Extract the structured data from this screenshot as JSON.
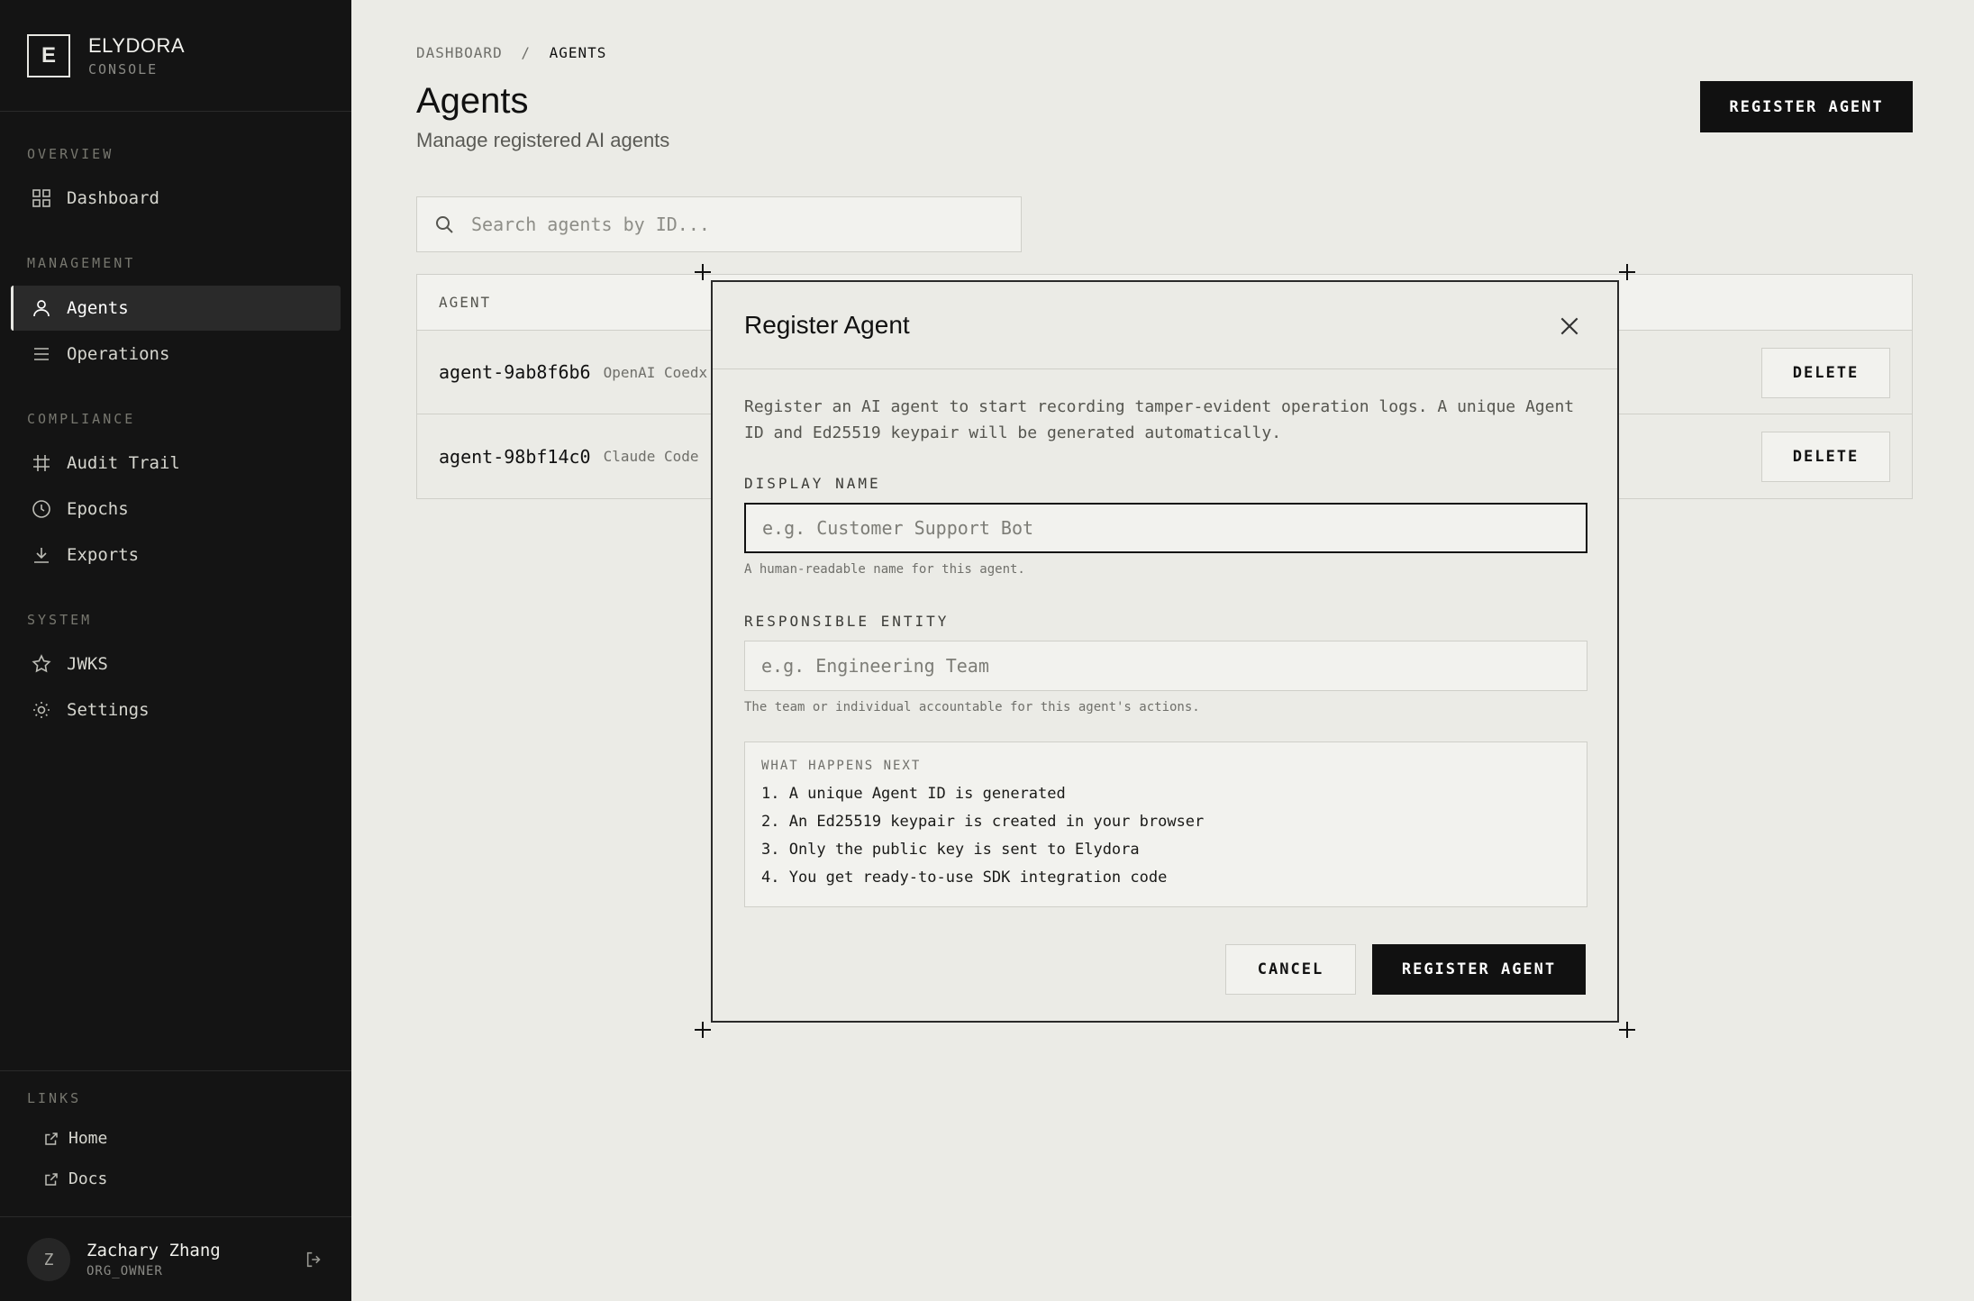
{
  "brand": {
    "letter": "E",
    "name": "ELYDORA",
    "sub": "CONSOLE"
  },
  "sidebar": {
    "sections": [
      {
        "title": "OVERVIEW",
        "items": [
          {
            "label": "Dashboard",
            "icon": "grid-icon"
          }
        ]
      },
      {
        "title": "MANAGEMENT",
        "items": [
          {
            "label": "Agents",
            "icon": "user-icon",
            "active": true
          },
          {
            "label": "Operations",
            "icon": "list-icon"
          }
        ]
      },
      {
        "title": "COMPLIANCE",
        "items": [
          {
            "label": "Audit Trail",
            "icon": "hash-icon"
          },
          {
            "label": "Epochs",
            "icon": "clock-icon"
          },
          {
            "label": "Exports",
            "icon": "download-icon"
          }
        ]
      },
      {
        "title": "SYSTEM",
        "items": [
          {
            "label": "JWKS",
            "icon": "star-icon"
          },
          {
            "label": "Settings",
            "icon": "sun-icon"
          }
        ]
      }
    ],
    "links": {
      "title": "LINKS",
      "items": [
        {
          "label": "Home"
        },
        {
          "label": "Docs"
        }
      ]
    },
    "user": {
      "initial": "Z",
      "name": "Zachary Zhang",
      "role": "ORG_OWNER"
    }
  },
  "header": {
    "breadcrumb": {
      "root": "DASHBOARD",
      "sep": "/",
      "current": "AGENTS"
    },
    "title": "Agents",
    "subtitle": "Manage registered AI agents",
    "register_label": "REGISTER AGENT"
  },
  "search": {
    "placeholder": "Search agents by ID..."
  },
  "table": {
    "header": "AGENT",
    "rows": [
      {
        "id": "agent-9ab8f6b6",
        "type": "OpenAI Coedx",
        "action": "DELETE"
      },
      {
        "id": "agent-98bf14c0",
        "type": "Claude Code",
        "action": "DELETE"
      }
    ]
  },
  "modal": {
    "title": "Register Agent",
    "description": "Register an AI agent to start recording tamper-evident operation logs. A unique Agent ID and Ed25519 keypair will be generated automatically.",
    "display_name": {
      "label": "DISPLAY NAME",
      "placeholder": "e.g. Customer Support Bot",
      "hint": "A human-readable name for this agent."
    },
    "responsible_entity": {
      "label": "RESPONSIBLE ENTITY",
      "placeholder": "e.g. Engineering Team",
      "hint": "The team or individual accountable for this agent's actions."
    },
    "next": {
      "title": "WHAT HAPPENS NEXT",
      "items": [
        "1. A unique Agent ID is generated",
        "2. An Ed25519 keypair is created in your browser",
        "3. Only the public key is sent to Elydora",
        "4. You get ready-to-use SDK integration code"
      ]
    },
    "cancel_label": "CANCEL",
    "register_label": "REGISTER AGENT"
  }
}
